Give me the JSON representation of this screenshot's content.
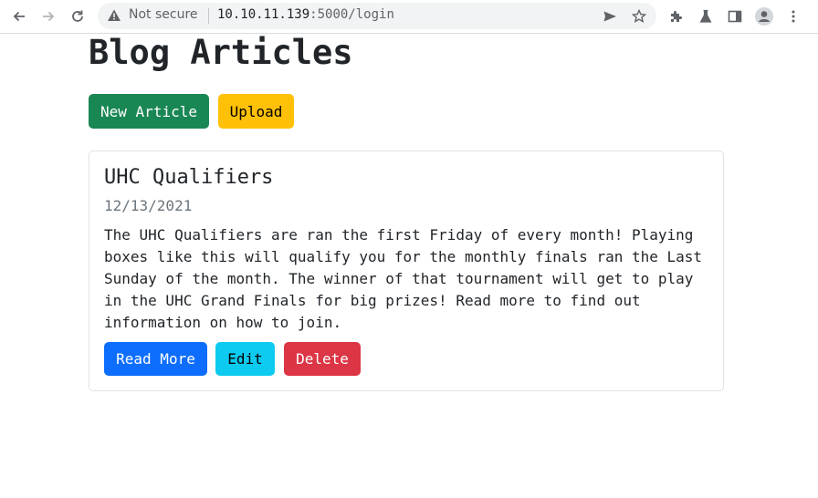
{
  "browser": {
    "security_label": "Not secure",
    "url_host": "10.10.11.139",
    "url_path": ":5000/login"
  },
  "page": {
    "title": "Blog Articles",
    "new_article_label": "New Article",
    "upload_label": "Upload"
  },
  "article": {
    "title": "UHC Qualifiers",
    "date": "12/13/2021",
    "body": "The UHC Qualifiers are ran the first Friday of every month! Playing boxes like this will qualify you for the monthly finals ran the Last Sunday of the month. The winner of that tournament will get to play in the UHC Grand Finals for big prizes! Read more to find out information on how to join.",
    "read_more_label": "Read More",
    "edit_label": "Edit",
    "delete_label": "Delete"
  },
  "colors": {
    "success": "#198754",
    "warning": "#ffc107",
    "primary": "#0d6efd",
    "info": "#0dcaf0",
    "danger": "#dc3545"
  }
}
